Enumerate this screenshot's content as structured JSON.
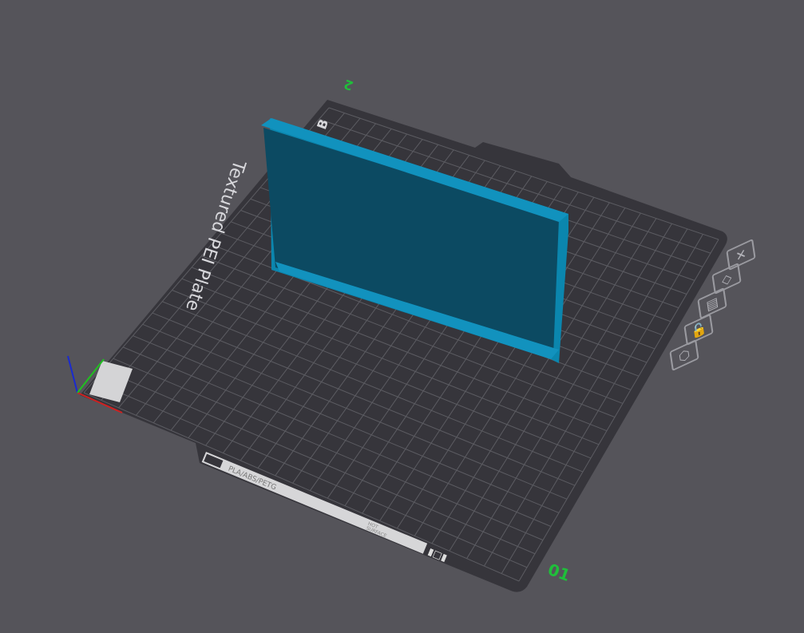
{
  "plate": {
    "name": "Textured PEI Plate",
    "material_label": "PLA/ABS/PETG",
    "warning_line1": "HOT",
    "warning_line2": "SURFACE",
    "plate_number": "01",
    "corner_mark": "B",
    "axis_mark": "2"
  },
  "colors": {
    "background": "#55545a",
    "plate": "#36353b",
    "grid": "#5c5c62",
    "model": "#0e85ad",
    "model_dark": "#0c4a62",
    "accent_green": "#1fbf3a"
  },
  "plate_toolbar": [
    {
      "icon": "close-icon",
      "glyph": "✕"
    },
    {
      "icon": "auto-orient-icon",
      "glyph": "◇"
    },
    {
      "icon": "arrange-icon",
      "glyph": "▤"
    },
    {
      "icon": "lock-icon",
      "glyph": "🔓"
    },
    {
      "icon": "settings-icon",
      "glyph": "⬡"
    }
  ]
}
